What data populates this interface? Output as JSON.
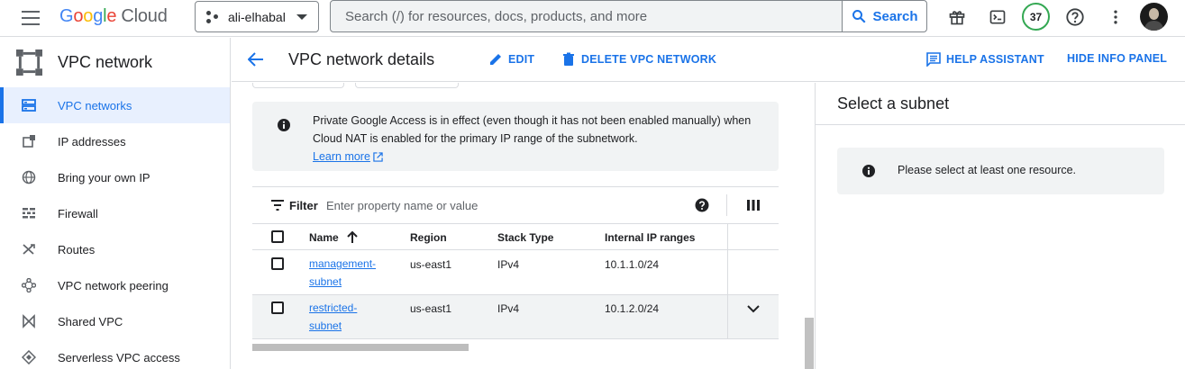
{
  "topbar": {
    "logo_letters": [
      "G",
      "o",
      "o",
      "g",
      "l",
      "e"
    ],
    "logo_suffix": "Cloud",
    "project": "ali-elhabal",
    "search_placeholder": "Search (/) for resources, docs, products, and more",
    "search_button": "Search",
    "notification_count": "37",
    "icons": [
      "menu-icon",
      "gift-icon",
      "cloud-shell-icon",
      "help-icon",
      "more-vert-icon",
      "avatar"
    ]
  },
  "sidebar": {
    "product_title": "VPC network",
    "items": [
      {
        "label": "VPC networks",
        "icon": "vpc-networks-icon",
        "active": true
      },
      {
        "label": "IP addresses",
        "icon": "ip-addresses-icon"
      },
      {
        "label": "Bring your own IP",
        "icon": "globe-icon"
      },
      {
        "label": "Firewall",
        "icon": "firewall-icon"
      },
      {
        "label": "Routes",
        "icon": "routes-icon"
      },
      {
        "label": "VPC network peering",
        "icon": "peering-icon"
      },
      {
        "label": "Shared VPC",
        "icon": "shared-vpc-icon"
      },
      {
        "label": "Serverless VPC access",
        "icon": "serverless-icon"
      }
    ]
  },
  "header": {
    "title": "VPC network details",
    "edit": "EDIT",
    "delete": "DELETE VPC NETWORK",
    "help_assistant": "HELP ASSISTANT",
    "hide_info_panel": "HIDE INFO PANEL"
  },
  "notice": {
    "text": "Private Google Access is in effect (even though it has not been enabled manually) when Cloud NAT is enabled for the primary IP range of the subnetwork.",
    "link": "Learn more"
  },
  "filter": {
    "label": "Filter",
    "placeholder": "Enter property name or value"
  },
  "table": {
    "columns": [
      "Name",
      "Region",
      "Stack Type",
      "Internal IP ranges"
    ],
    "sort_column": "Name",
    "sort_direction": "ascending",
    "rows": [
      {
        "name_line1": "management-",
        "name_line2": "subnet",
        "region": "us-east1",
        "stack": "IPv4",
        "range": "10.1.1.0/24"
      },
      {
        "name_line1": "restricted-",
        "name_line2": "subnet",
        "region": "us-east1",
        "stack": "IPv4",
        "range": "10.1.2.0/24"
      }
    ]
  },
  "info_panel": {
    "title": "Select a subnet",
    "message": "Please select at least one resource."
  },
  "colors": {
    "accent": "#1a73e8",
    "active_bg": "#e8f0fe",
    "notice_bg": "#f1f3f4",
    "badge_ring": "#34a853"
  }
}
